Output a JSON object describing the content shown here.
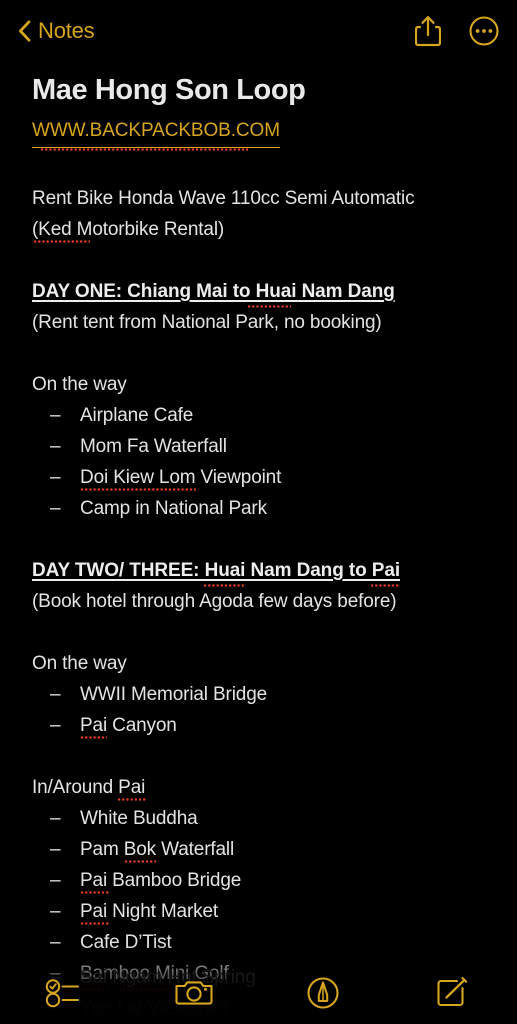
{
  "app": {
    "name": "Notes",
    "accent_color": "#D5A520",
    "text_color": "#E3E3E4",
    "background_color": "#000000",
    "spellcheck_color": "#E23B27"
  },
  "navbar": {
    "back_label": "Notes",
    "back_icon": "chevron-left-icon",
    "share_icon": "share-icon",
    "more_icon": "more-ellipsis-icon"
  },
  "note": {
    "title": "Mae Hong Son Loop",
    "link": "WWW.BACKPACKBOB.COM",
    "lines": {
      "l1": "Rent Bike Honda Wave 110cc Semi Automatic",
      "l2": "(Ked Motorbike Rental)",
      "day_one_heading": "DAY ONE: Chiang Mai to Huai Nam Dang",
      "day_one_note": "(Rent tent from National Park, no booking)",
      "on_the_way_1": "On the way",
      "day_two_heading": "DAY TWO/ THREE: Huai Nam Dang to Pai",
      "day_two_note": "(Book hotel through Agoda few days before)",
      "on_the_way_2": "On the way",
      "in_around_pai": "In/Around Pai"
    },
    "day_one_items": [
      "Airplane Cafe",
      "Mom Fa Waterfall",
      "Doi Kiew Lom Viewpoint",
      "Camp in National Park"
    ],
    "day_two_items": [
      "WWII Memorial Bridge",
      "Pai Canyon"
    ],
    "pai_items": [
      "White Buddha",
      "Pam Bok Waterfall",
      "Pai Bamboo Bridge",
      "Pai Night Market",
      "Cafe D’Tist",
      "Bamboo Mini Golf"
    ],
    "tail_items": [
      "Sai Ngam Hot Spring",
      "Yun Lai Viewpoint"
    ],
    "bullet_dash": "–"
  },
  "toolbar": {
    "checklist_icon": "checklist-icon",
    "camera_icon": "camera-icon",
    "markup_icon": "markup-pen-icon",
    "compose_icon": "compose-icon"
  }
}
